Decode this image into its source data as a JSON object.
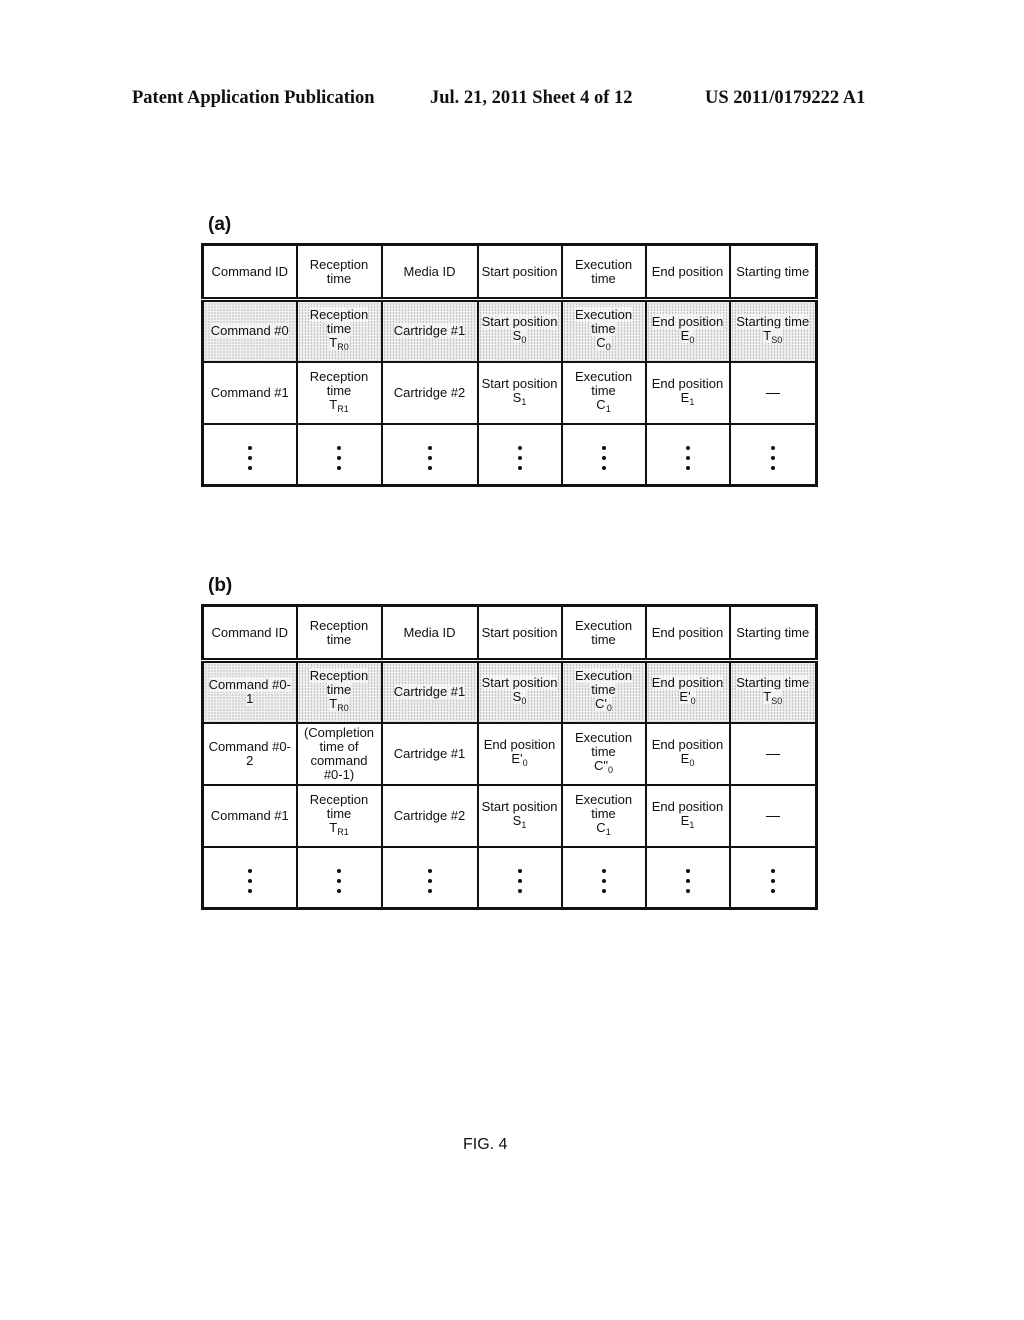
{
  "header": {
    "left": "Patent Application Publication",
    "middle": "Jul. 21, 2011   Sheet 4 of 12",
    "right": "US 2011/0179222 A1"
  },
  "columns": [
    "Command ID",
    "Reception time",
    "Media ID",
    "Start position",
    "Execution time",
    "End position",
    "Starting time"
  ],
  "panel_a": {
    "label": "(a)",
    "rows": [
      {
        "shaded": true,
        "cells": [
          {
            "main": "Command #0",
            "sub_base": "",
            "sub": ""
          },
          {
            "main": "Reception time",
            "sub_base": "T",
            "sub": "R0"
          },
          {
            "main": "Cartridge #1",
            "sub_base": "",
            "sub": ""
          },
          {
            "main": "Start position",
            "sub_base": "S",
            "sub": "0"
          },
          {
            "main": "Execution time",
            "sub_base": "C",
            "sub": "0"
          },
          {
            "main": "End position",
            "sub_base": "E",
            "sub": "0"
          },
          {
            "main": "Starting time",
            "sub_base": "T",
            "sub": "S0"
          }
        ]
      },
      {
        "shaded": false,
        "cells": [
          {
            "main": "Command #1",
            "sub_base": "",
            "sub": ""
          },
          {
            "main": "Reception time",
            "sub_base": "T",
            "sub": "R1"
          },
          {
            "main": "Cartridge #2",
            "sub_base": "",
            "sub": ""
          },
          {
            "main": "Start position",
            "sub_base": "S",
            "sub": "1"
          },
          {
            "main": "Execution time",
            "sub_base": "C",
            "sub": "1"
          },
          {
            "main": "End position",
            "sub_base": "E",
            "sub": "1"
          },
          {
            "main": "—",
            "sub_base": "",
            "sub": ""
          }
        ]
      }
    ],
    "ellipsis": "⋮"
  },
  "panel_b": {
    "label": "(b)",
    "rows": [
      {
        "shaded": true,
        "cells": [
          {
            "main": "Command #0-1",
            "sub_base": "",
            "sub": ""
          },
          {
            "main": "Reception time",
            "sub_base": "T",
            "sub": "R0"
          },
          {
            "main": "Cartridge #1",
            "sub_base": "",
            "sub": ""
          },
          {
            "main": "Start position",
            "sub_base": "S",
            "sub": "0"
          },
          {
            "main": "Execution time",
            "sub_base": "C'",
            "sub": "0"
          },
          {
            "main": "End position",
            "sub_base": "E'",
            "sub": "0"
          },
          {
            "main": "Starting time",
            "sub_base": "T",
            "sub": "S0"
          }
        ]
      },
      {
        "shaded": false,
        "cells": [
          {
            "main": "Command #0-2",
            "sub_base": "",
            "sub": ""
          },
          {
            "main": "(Completion time of command #0-1)",
            "sub_base": "",
            "sub": ""
          },
          {
            "main": "Cartridge #1",
            "sub_base": "",
            "sub": ""
          },
          {
            "main": "End position",
            "sub_base": "E'",
            "sub": "0"
          },
          {
            "main": "Execution time",
            "sub_base": "C\"",
            "sub": "0"
          },
          {
            "main": "End position",
            "sub_base": "E",
            "sub": "0"
          },
          {
            "main": "—",
            "sub_base": "",
            "sub": ""
          }
        ]
      },
      {
        "shaded": false,
        "cells": [
          {
            "main": "Command #1",
            "sub_base": "",
            "sub": ""
          },
          {
            "main": "Reception time",
            "sub_base": "T",
            "sub": "R1"
          },
          {
            "main": "Cartridge #2",
            "sub_base": "",
            "sub": ""
          },
          {
            "main": "Start position",
            "sub_base": "S",
            "sub": "1"
          },
          {
            "main": "Execution time",
            "sub_base": "C",
            "sub": "1"
          },
          {
            "main": "End position",
            "sub_base": "E",
            "sub": "1"
          },
          {
            "main": "—",
            "sub_base": "",
            "sub": ""
          }
        ]
      }
    ],
    "ellipsis": "⋮"
  },
  "figure_label": "FIG. 4"
}
